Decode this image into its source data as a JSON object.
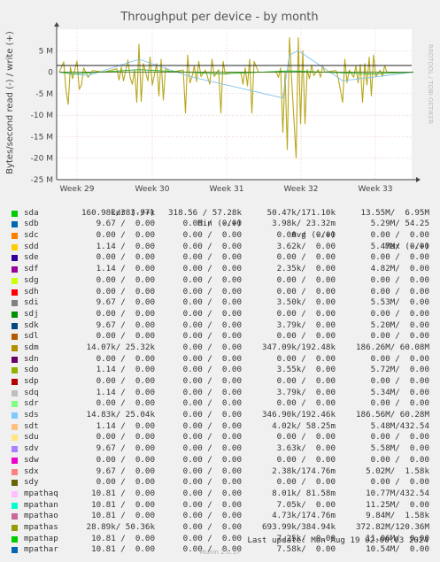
{
  "chart_data": {
    "type": "line",
    "title": "Throughput per device - by month",
    "ylabel": "Bytes/second read (-) / write (+)",
    "ylim": [
      -25000000,
      10000000
    ],
    "yticks": [
      {
        "v": 5000000,
        "label": "5 M"
      },
      {
        "v": 0,
        "label": "0"
      },
      {
        "v": -5000000,
        "label": "-5 M"
      },
      {
        "v": -10000000,
        "label": "-10 M"
      },
      {
        "v": -15000000,
        "label": "-15 M"
      },
      {
        "v": -20000000,
        "label": "-20 M"
      },
      {
        "v": -25000000,
        "label": "-25 M"
      }
    ],
    "xticks": [
      "Week 29",
      "Week 30",
      "Week 31",
      "Week 32",
      "Week 33"
    ],
    "grid": true,
    "series": [
      {
        "name": "sdm",
        "color": "#b8a61a",
        "points": [
          [
            0,
            0
          ],
          [
            2,
            2.4
          ],
          [
            3,
            -4.2
          ],
          [
            4,
            -7.5
          ],
          [
            5,
            1.2
          ],
          [
            6,
            -1.5
          ],
          [
            8,
            2.6
          ],
          [
            9,
            -4
          ],
          [
            10,
            -3
          ],
          [
            11,
            1
          ],
          [
            13,
            -1.2
          ],
          [
            15,
            0.4
          ],
          [
            20,
            0
          ],
          [
            26,
            0.8
          ],
          [
            27,
            -1.8
          ],
          [
            28,
            1.2
          ],
          [
            29,
            -2
          ],
          [
            31,
            2.8
          ],
          [
            32,
            -1.2
          ],
          [
            33,
            -2.8
          ],
          [
            34,
            0.5
          ],
          [
            35,
            -7
          ],
          [
            36,
            6.5
          ],
          [
            37,
            -6.8
          ],
          [
            38,
            2
          ],
          [
            40,
            -2
          ],
          [
            41,
            3.5
          ],
          [
            42,
            -3
          ],
          [
            43,
            -0.5
          ],
          [
            44,
            2
          ],
          [
            45,
            -5.5
          ],
          [
            46,
            3
          ],
          [
            47,
            -6.5
          ],
          [
            48,
            1
          ],
          [
            50,
            0
          ],
          [
            56,
            0.5
          ],
          [
            57,
            -9.5
          ],
          [
            58,
            4
          ],
          [
            59,
            -2.5
          ],
          [
            60,
            -1
          ],
          [
            61,
            1.5
          ],
          [
            62,
            -2.2
          ],
          [
            63,
            2.5
          ],
          [
            64,
            -1
          ],
          [
            66,
            0.5
          ],
          [
            68,
            -2.8
          ],
          [
            69,
            3
          ],
          [
            70,
            -1
          ],
          [
            72,
            0.6
          ],
          [
            73,
            -9.5
          ],
          [
            74,
            2.5
          ],
          [
            75,
            -0.5
          ],
          [
            77,
            0
          ],
          [
            82,
            0
          ],
          [
            83,
            -2.8
          ],
          [
            84,
            1
          ],
          [
            85,
            -3.2
          ],
          [
            86,
            3
          ],
          [
            87,
            -9.5
          ],
          [
            88,
            2.5
          ],
          [
            90,
            0
          ],
          [
            98,
            0
          ],
          [
            99,
            -1.2
          ],
          [
            100,
            1
          ],
          [
            101,
            -14
          ],
          [
            102,
            0
          ],
          [
            103,
            -18
          ],
          [
            104,
            8
          ],
          [
            105,
            -2
          ],
          [
            107,
            -20
          ],
          [
            108,
            8
          ],
          [
            109,
            -12
          ],
          [
            110,
            5
          ],
          [
            111,
            -12
          ],
          [
            112,
            0.6
          ],
          [
            113,
            -1.5
          ],
          [
            114,
            1.6
          ],
          [
            115,
            -0.8
          ],
          [
            117,
            0.6
          ],
          [
            118,
            -1.2
          ],
          [
            119,
            1.4
          ],
          [
            120,
            0
          ],
          [
            125,
            0.4
          ],
          [
            126,
            -1.3
          ],
          [
            128,
            -7
          ],
          [
            129,
            3
          ],
          [
            130,
            -2.4
          ],
          [
            131,
            0.5
          ],
          [
            133,
            -1.2
          ],
          [
            134,
            1.5
          ],
          [
            135,
            -2.5
          ],
          [
            136,
            1.8
          ],
          [
            137,
            -7
          ],
          [
            138,
            2
          ],
          [
            139,
            -3
          ],
          [
            140,
            3.5
          ],
          [
            141,
            -5.5
          ],
          [
            142,
            4
          ],
          [
            143,
            -1
          ],
          [
            145,
            0.5
          ],
          [
            146,
            -1
          ],
          [
            147,
            1.5
          ],
          [
            148,
            0
          ],
          [
            155,
            0
          ],
          [
            160,
            0
          ]
        ]
      },
      {
        "name": "sds",
        "color": "#80c0ee",
        "points": [
          [
            0,
            0
          ],
          [
            13,
            -0.8
          ],
          [
            36,
            3
          ],
          [
            59,
            -1
          ],
          [
            101,
            -6
          ],
          [
            104,
            4
          ],
          [
            108,
            5
          ],
          [
            128,
            -2
          ],
          [
            160,
            0
          ]
        ]
      },
      {
        "name": "sda",
        "color": "#22aa22",
        "points": [
          [
            0,
            0
          ],
          [
            6,
            -0.4
          ],
          [
            36,
            0.6
          ],
          [
            73,
            -0.4
          ],
          [
            104,
            0.3
          ],
          [
            141,
            -0.4
          ],
          [
            160,
            0
          ]
        ]
      },
      {
        "name": "mpathas",
        "color": "#447722",
        "points": [
          [
            0,
            0
          ],
          [
            160,
            0
          ]
        ]
      }
    ],
    "legend_header": {
      "cur": "Cur (-/+)",
      "min": "Min (-/+)",
      "avg": "Avg (-/+)",
      "max": "Max (-/+)"
    },
    "legend": [
      {
        "name": "sda",
        "color": "#00cc00",
        "cur": "160.98k/383.97k",
        "min": "318.56 / 57.28k",
        "avg": "50.47k/171.10k",
        "max": "13.55M/  6.95M"
      },
      {
        "name": "sdb",
        "color": "#0066b3",
        "cur": "9.67 /  0.00",
        "min": "0.00 /  0.00",
        "avg": "3.98k/ 23.32m",
        "max": "5.29M/ 54.25"
      },
      {
        "name": "sdc",
        "color": "#ff8000",
        "cur": "0.00 /  0.00",
        "min": "0.00 /  0.00",
        "avg": "0.00 /  0.00",
        "max": "0.00 /  0.00"
      },
      {
        "name": "sdd",
        "color": "#ffcc00",
        "cur": "1.14 /  0.00",
        "min": "0.00 /  0.00",
        "avg": "3.62k/  0.00",
        "max": "5.47M/  0.00"
      },
      {
        "name": "sde",
        "color": "#330099",
        "cur": "0.00 /  0.00",
        "min": "0.00 /  0.00",
        "avg": "0.00 /  0.00",
        "max": "0.00 /  0.00"
      },
      {
        "name": "sdf",
        "color": "#990099",
        "cur": "1.14 /  0.00",
        "min": "0.00 /  0.00",
        "avg": "2.35k/  0.00",
        "max": "4.82M/  0.00"
      },
      {
        "name": "sdg",
        "color": "#ccff00",
        "cur": "0.00 /  0.00",
        "min": "0.00 /  0.00",
        "avg": "0.00 /  0.00",
        "max": "0.00 /  0.00"
      },
      {
        "name": "sdh",
        "color": "#ff0000",
        "cur": "0.00 /  0.00",
        "min": "0.00 /  0.00",
        "avg": "0.00 /  0.00",
        "max": "0.00 /  0.00"
      },
      {
        "name": "sdi",
        "color": "#808080",
        "cur": "9.67 /  0.00",
        "min": "0.00 /  0.00",
        "avg": "3.50k/  0.00",
        "max": "5.53M/  0.00"
      },
      {
        "name": "sdj",
        "color": "#008f00",
        "cur": "0.00 /  0.00",
        "min": "0.00 /  0.00",
        "avg": "0.00 /  0.00",
        "max": "0.00 /  0.00"
      },
      {
        "name": "sdk",
        "color": "#00487d",
        "cur": "9.67 /  0.00",
        "min": "0.00 /  0.00",
        "avg": "3.79k/  0.00",
        "max": "5.20M/  0.00"
      },
      {
        "name": "sdl",
        "color": "#b35a00",
        "cur": "0.00 /  0.00",
        "min": "0.00 /  0.00",
        "avg": "0.00 /  0.00",
        "max": "0.00 /  0.00"
      },
      {
        "name": "sdm",
        "color": "#b38f00",
        "cur": "14.07k/ 25.32k",
        "min": "0.00 /  0.00",
        "avg": "347.09k/192.48k",
        "max": "186.26M/ 60.08M"
      },
      {
        "name": "sdn",
        "color": "#6b006b",
        "cur": "0.00 /  0.00",
        "min": "0.00 /  0.00",
        "avg": "0.00 /  0.00",
        "max": "0.00 /  0.00"
      },
      {
        "name": "sdo",
        "color": "#8fb300",
        "cur": "1.14 /  0.00",
        "min": "0.00 /  0.00",
        "avg": "3.55k/  0.00",
        "max": "5.72M/  0.00"
      },
      {
        "name": "sdp",
        "color": "#b30000",
        "cur": "0.00 /  0.00",
        "min": "0.00 /  0.00",
        "avg": "0.00 /  0.00",
        "max": "0.00 /  0.00"
      },
      {
        "name": "sdq",
        "color": "#bebebe",
        "cur": "1.14 /  0.00",
        "min": "0.00 /  0.00",
        "avg": "3.79k/  0.00",
        "max": "5.34M/  0.00"
      },
      {
        "name": "sdr",
        "color": "#80ff80",
        "cur": "0.00 /  0.00",
        "min": "0.00 /  0.00",
        "avg": "0.00 /  0.00",
        "max": "0.00 /  0.00"
      },
      {
        "name": "sds",
        "color": "#80c9ff",
        "cur": "14.83k/ 25.04k",
        "min": "0.00 /  0.00",
        "avg": "346.90k/192.46k",
        "max": "186.56M/ 60.28M"
      },
      {
        "name": "sdt",
        "color": "#ffc080",
        "cur": "1.14 /  0.00",
        "min": "0.00 /  0.00",
        "avg": "4.02k/ 58.25m",
        "max": "5.48M/432.54"
      },
      {
        "name": "sdu",
        "color": "#ffe680",
        "cur": "0.00 /  0.00",
        "min": "0.00 /  0.00",
        "avg": "0.00 /  0.00",
        "max": "0.00 /  0.00"
      },
      {
        "name": "sdv",
        "color": "#aa80ff",
        "cur": "9.67 /  0.00",
        "min": "0.00 /  0.00",
        "avg": "3.63k/  0.00",
        "max": "5.58M/  0.00"
      },
      {
        "name": "sdw",
        "color": "#ee00cc",
        "cur": "0.00 /  0.00",
        "min": "0.00 /  0.00",
        "avg": "0.00 /  0.00",
        "max": "0.00 /  0.00"
      },
      {
        "name": "sdx",
        "color": "#ff8080",
        "cur": "9.67 /  0.00",
        "min": "0.00 /  0.00",
        "avg": "2.38k/174.76m",
        "max": "5.02M/  1.58k"
      },
      {
        "name": "sdy",
        "color": "#666600",
        "cur": "0.00 /  0.00",
        "min": "0.00 /  0.00",
        "avg": "0.00 /  0.00",
        "max": "0.00 /  0.00"
      },
      {
        "name": "mpathaq",
        "color": "#ffbfff",
        "cur": "10.81 /  0.00",
        "min": "0.00 /  0.00",
        "avg": "8.01k/ 81.58m",
        "max": "10.77M/432.54"
      },
      {
        "name": "mpathan",
        "color": "#00ffcc",
        "cur": "10.81 /  0.00",
        "min": "0.00 /  0.00",
        "avg": "7.05k/  0.00",
        "max": "11.25M/  0.00"
      },
      {
        "name": "mpathao",
        "color": "#cc6699",
        "cur": "10.81 /  0.00",
        "min": "0.00 /  0.00",
        "avg": "4.73k/174.76m",
        "max": "9.84M/  1.58k"
      },
      {
        "name": "mpathas",
        "color": "#999900",
        "cur": "28.89k/ 50.36k",
        "min": "0.00 /  0.00",
        "avg": "693.99k/384.94k",
        "max": "372.82M/120.36M"
      },
      {
        "name": "mpathap",
        "color": "#00cc00",
        "cur": "10.81 /  0.00",
        "min": "0.00 /  0.00",
        "avg": "7.25k/  0.00",
        "max": "11.06M/  0.00"
      },
      {
        "name": "mpathar",
        "color": "#0066b3",
        "cur": "10.81 /  0.00",
        "min": "0.00 /  0.00",
        "avg": "7.58k/  0.00",
        "max": "10.54M/  0.00"
      }
    ]
  },
  "side_label": "RRDTOOL / TOBI OETIKER",
  "last_update": "Last update: Mon Aug 19 02:00:03 2024",
  "version": "Munin 2.0.57"
}
